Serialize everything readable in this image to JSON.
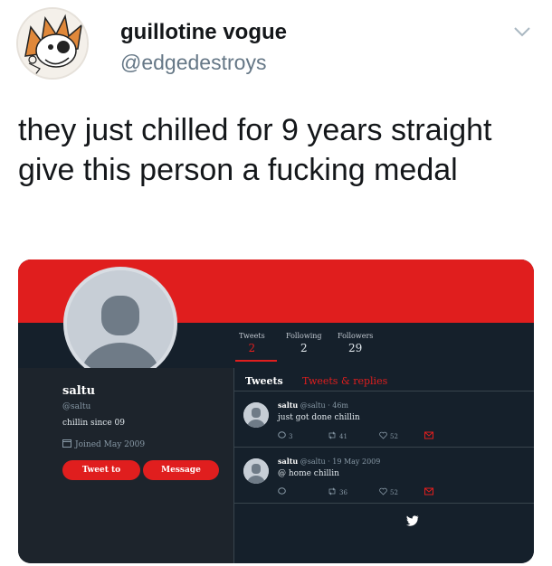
{
  "tweet": {
    "display_name": "guillotine vogue",
    "handle": "@edgedestroys",
    "text": "they just chilled for 9 years straight give this person a fucking medal",
    "avatar_icon": "cartoon-avatar",
    "menu_icon": "chevron-down-icon"
  },
  "screenshot": {
    "colors": {
      "accent": "#e01e1e",
      "dark_bg": "#15202b",
      "panel_bg": "#1d242c"
    },
    "stats": [
      {
        "label": "Tweets",
        "value": "2"
      },
      {
        "label": "Following",
        "value": "2"
      },
      {
        "label": "Followers",
        "value": "29"
      }
    ],
    "profile": {
      "name": "saltu",
      "username": "@saltu",
      "bio": "chillin since 09",
      "joined": "Joined May 2009",
      "tweet_to_label": "Tweet to",
      "message_label": "Message"
    },
    "tabs": {
      "tweets": "Tweets",
      "tweets_replies": "Tweets & replies"
    },
    "posts": [
      {
        "name": "saltu",
        "meta": "@saltu · 46m",
        "text": "just got done chillin",
        "replies": "3",
        "retweets": "41",
        "likes": "52"
      },
      {
        "name": "saltu",
        "meta": "@saltu · 19 May 2009",
        "text": "@ home chillin",
        "replies": "",
        "retweets": "36",
        "likes": "52"
      }
    ]
  }
}
